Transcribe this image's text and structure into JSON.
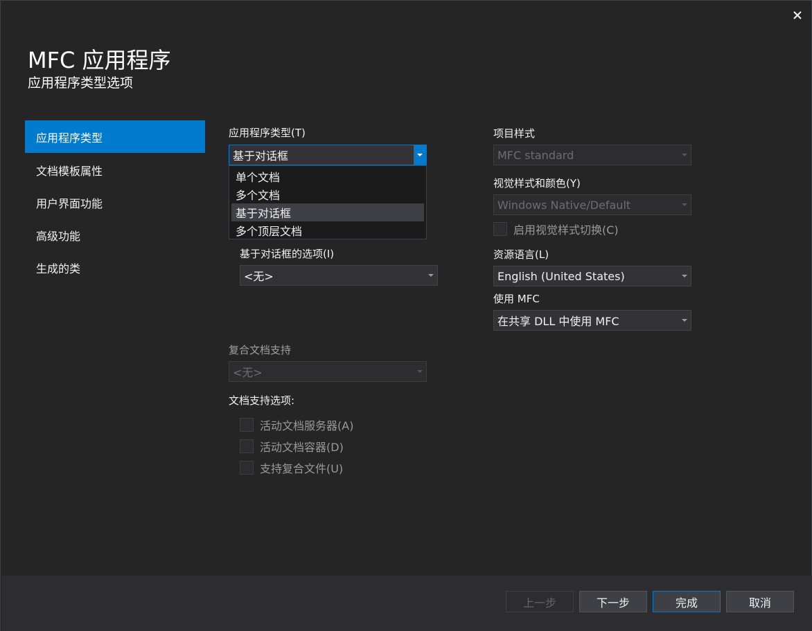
{
  "window": {
    "title": "MFC 应用程序",
    "subtitle": "应用程序类型选项",
    "close_symbol": "✕"
  },
  "sidebar": {
    "items": [
      {
        "label": "应用程序类型",
        "selected": true
      },
      {
        "label": "文档模板属性",
        "selected": false
      },
      {
        "label": "用户界面功能",
        "selected": false
      },
      {
        "label": "高级功能",
        "selected": false
      },
      {
        "label": "生成的类",
        "selected": false
      }
    ]
  },
  "app_type": {
    "label": "应用程序类型(T)",
    "value": "基于对话框",
    "options": [
      "单个文档",
      "多个文档",
      "基于对话框",
      "多个顶层文档"
    ],
    "highlighted_index": 2
  },
  "dialog_options": {
    "label": "基于对话框的选项(I)",
    "value": "<无>"
  },
  "compound_doc": {
    "label": "复合文档支持",
    "value": "<无>"
  },
  "doc_support": {
    "label": "文档支持选项:",
    "checkboxes": [
      {
        "label": "活动文档服务器(A)",
        "checked": false
      },
      {
        "label": "活动文档容器(D)",
        "checked": false
      },
      {
        "label": "支持复合文件(U)",
        "checked": false
      }
    ]
  },
  "project_style": {
    "label": "项目样式",
    "value": "MFC standard"
  },
  "visual_style": {
    "label": "视觉样式和颜色(Y)",
    "value": "Windows Native/Default",
    "toggle_label": "启用视觉样式切换(C)",
    "toggle_checked": false
  },
  "resource_language": {
    "label": "资源语言(L)",
    "value": "English (United States)"
  },
  "use_mfc": {
    "label": "使用 MFC",
    "value": "在共享 DLL 中使用 MFC"
  },
  "buttons": {
    "back": "上一步",
    "next": "下一步",
    "finish": "完成",
    "cancel": "取消"
  },
  "colors": {
    "background": "#252526",
    "accent": "#007acc",
    "footer": "#2d2d30"
  }
}
